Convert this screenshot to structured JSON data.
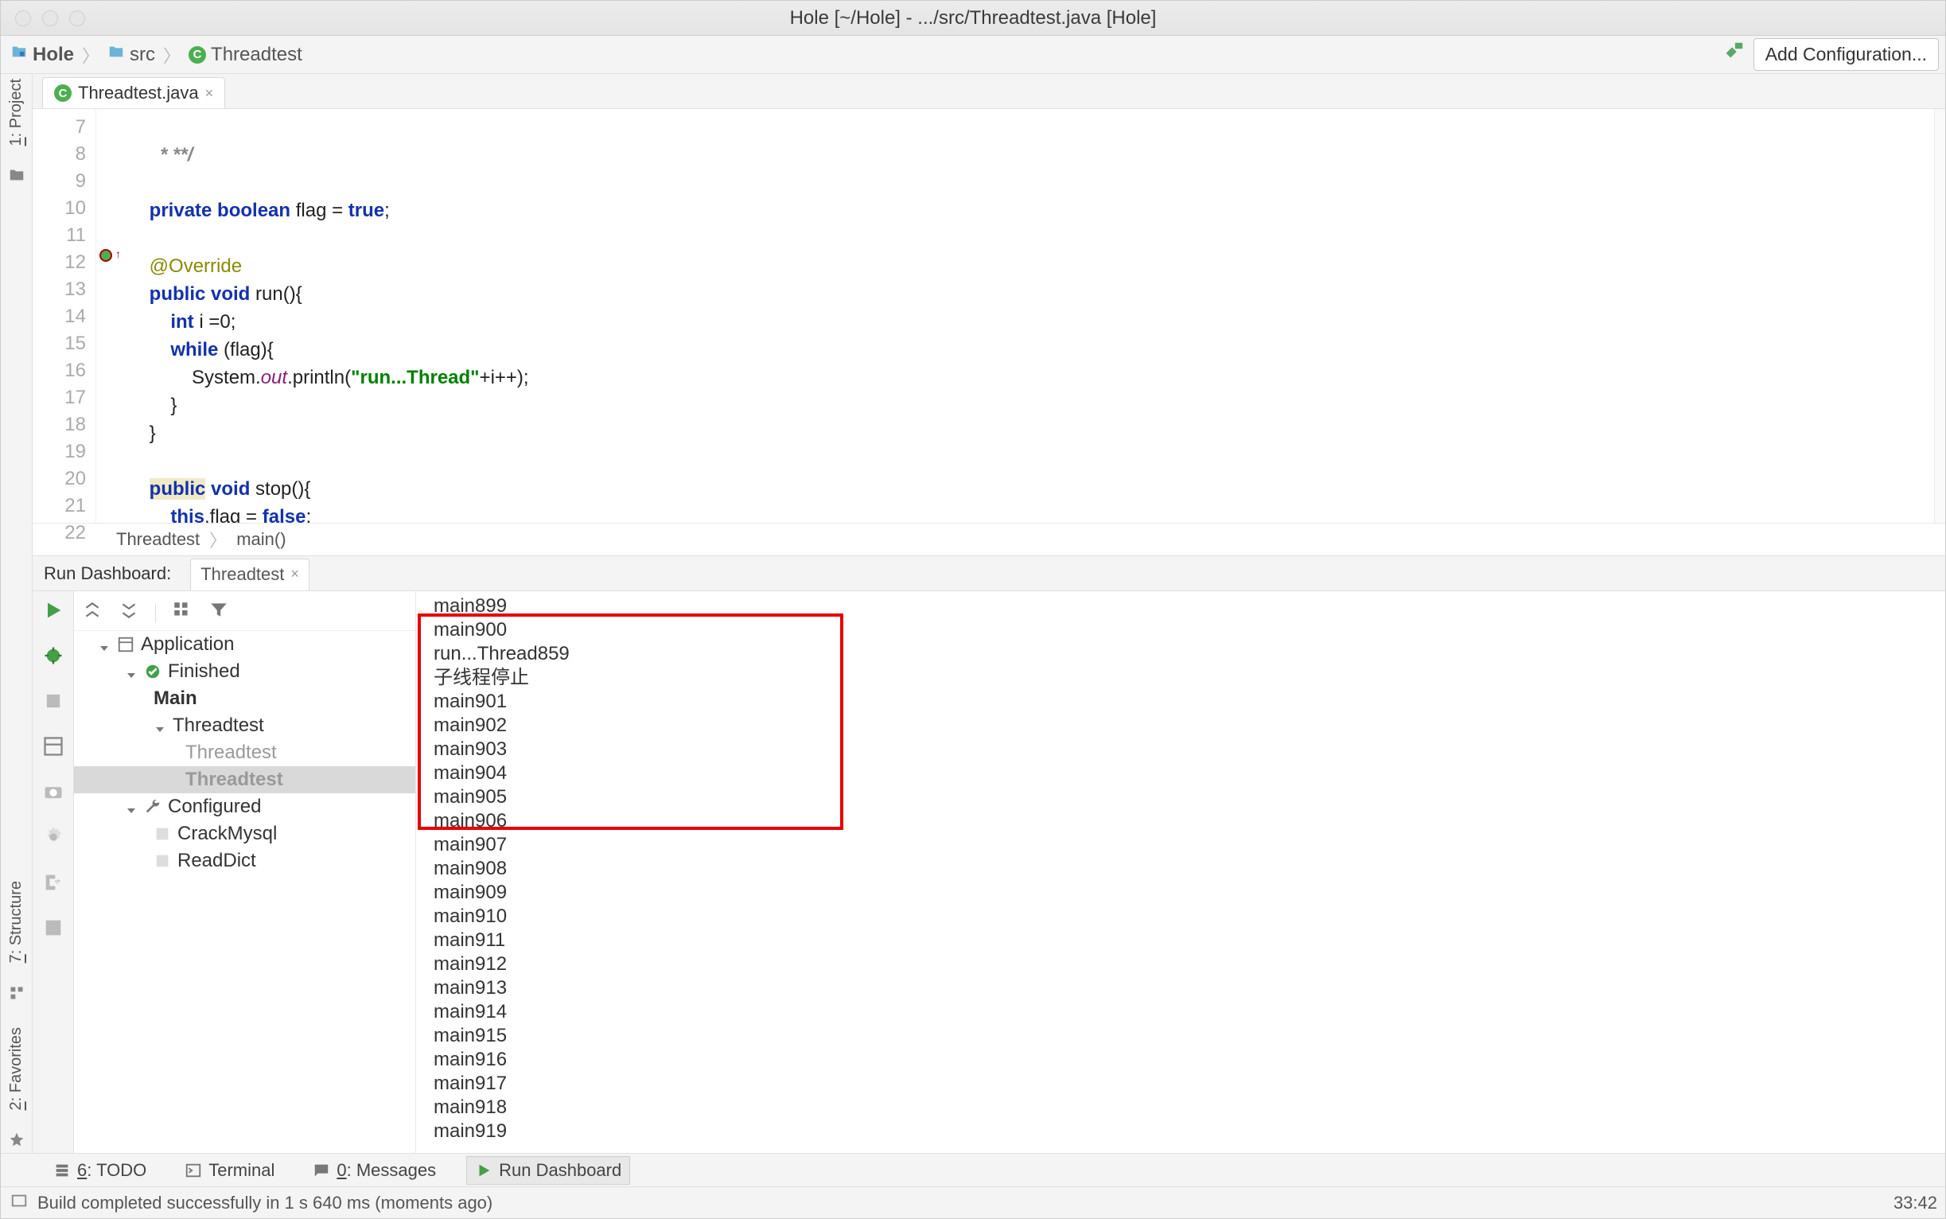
{
  "window_title": "Hole [~/Hole] - .../src/Threadtest.java [Hole]",
  "breadcrumbs": {
    "b0": "Hole",
    "b1": "src",
    "b2": "Threadtest"
  },
  "toolbar": {
    "add_config": "Add Configuration..."
  },
  "editor_tab": {
    "name": "Threadtest.java"
  },
  "left_sidebar": {
    "project_u": "1",
    "project": ": Project"
  },
  "left_sidebar2": {
    "structure_u": "7",
    "structure": ": Structure",
    "favorites_u": "2",
    "favorites": ": Favorites"
  },
  "gutter_start": 7,
  "gutter_end": 22,
  "code_tokens": {
    "l7": " * **/",
    "l9a": "private boolean",
    "l9b": " flag = ",
    "l9c": "true",
    "l9d": ";",
    "l11": "@Override",
    "l12a": "public void",
    "l12b": " run(){",
    "l13a": "int",
    "l13b": " i =",
    "l13c": "0",
    "l13d": ";",
    "l14a": "while",
    "l14b": " (flag){",
    "l15a": "System.",
    "l15b": "out",
    "l15c": ".println(",
    "l15d": "\"run...Thread\"",
    "l15e": "+i++);",
    "l16": "}",
    "l17": "}",
    "l19a": "public",
    "l19b": " void",
    "l19c": " stop(){",
    "l20a": "this",
    "l20b": ".flag = ",
    "l20c": "false",
    "l20d": ";",
    "l21": "}"
  },
  "editor_crumb": {
    "c0": "Threadtest",
    "c1": "main()"
  },
  "panel": {
    "title": "Run Dashboard:",
    "tab": "Threadtest"
  },
  "tree": {
    "root": "Application",
    "finished": "Finished",
    "main": "Main",
    "threadtest": "Threadtest",
    "threadtest_run1": "Threadtest",
    "threadtest_run2": "Threadtest",
    "configured": "Configured",
    "crackmysql": "CrackMysql",
    "readdict": "ReadDict"
  },
  "console_lines": [
    "main899",
    "main900",
    "run...Thread859",
    "子线程停止",
    "main901",
    "main902",
    "main903",
    "main904",
    "main905",
    "main906",
    "main907",
    "main908",
    "main909",
    "main910",
    "main911",
    "main912",
    "main913",
    "main914",
    "main915",
    "main916",
    "main917",
    "main918",
    "main919"
  ],
  "bottom_tabs": {
    "todo_u": "6",
    "todo": ": TODO",
    "terminal": "Terminal",
    "messages_u": "0",
    "messages": ": Messages",
    "rundash": "Run Dashboard"
  },
  "status": {
    "text": "Build completed successfully in 1 s 640 ms (moments ago)",
    "pos": "33:42"
  }
}
